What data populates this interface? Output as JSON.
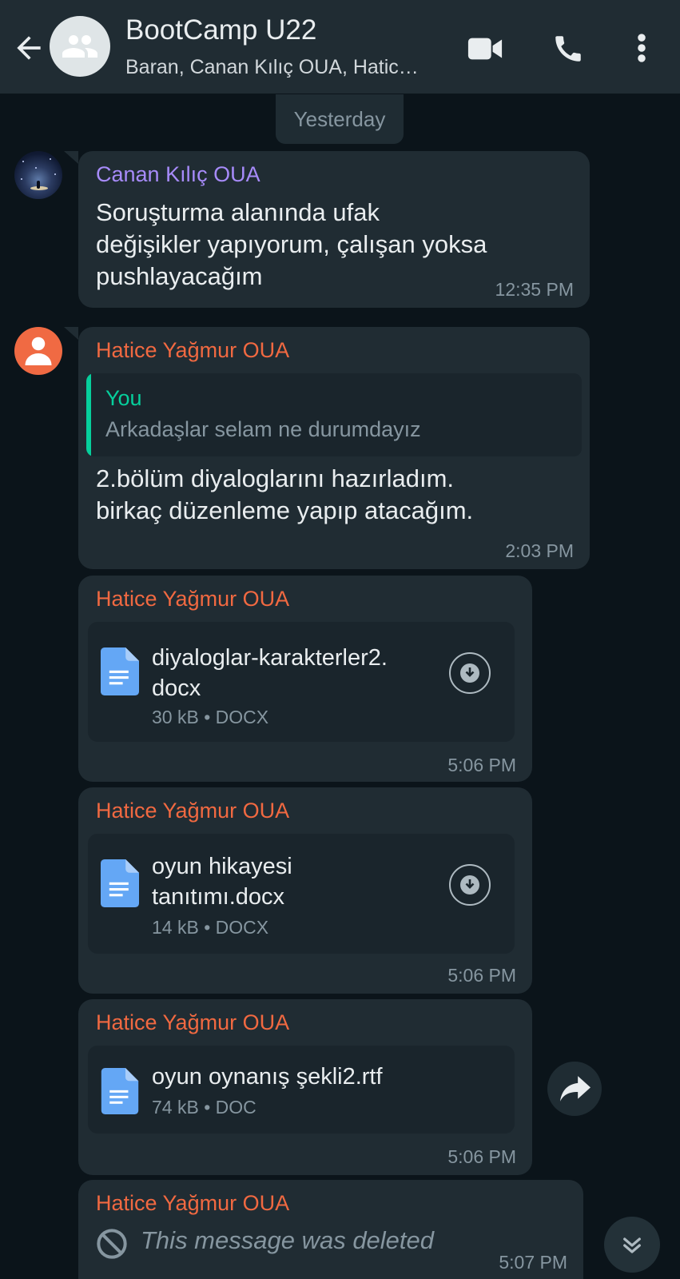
{
  "header": {
    "title": "BootCamp U22",
    "subtitle": "Baran, Canan Kılıç OUA, Hatic…",
    "icons": [
      "back-arrow-icon",
      "group-avatar-icon",
      "video-call-icon",
      "phone-icon",
      "more-vertical-icon"
    ]
  },
  "date_chip": "Yesterday",
  "messages": [
    {
      "sender": "Canan Kılıç OUA",
      "text_lines": [
        "Soruşturma alanında ufak",
        "değişikler yapıyorum, çalışan yoksa",
        "pushlayacağım"
      ],
      "time": "12:35 PM"
    },
    {
      "sender": "Hatice Yağmur OUA",
      "quote": {
        "author": "You",
        "text": "Arkadaşlar selam ne durumdayız"
      },
      "text_lines": [
        "2.bölüm diyaloglarını hazırladım.",
        "birkaç düzenleme yapıp atacağım."
      ],
      "time": "2:03 PM"
    },
    {
      "sender": "Hatice Yağmur OUA",
      "doc": {
        "name_lines": [
          "diyaloglar-karakterler2.",
          "docx"
        ],
        "meta": "30 kB • DOCX"
      },
      "time": "5:06 PM"
    },
    {
      "sender": "Hatice Yağmur OUA",
      "doc": {
        "name_lines": [
          "oyun hikayesi",
          "tanıtımı.docx"
        ],
        "meta": "14 kB • DOCX"
      },
      "time": "5:06 PM"
    },
    {
      "sender": "Hatice Yağmur OUA",
      "doc": {
        "name_lines": [
          "oyun oynanış şekli2.rtf"
        ],
        "meta": "74 kB • DOC"
      },
      "time": "5:06 PM"
    },
    {
      "sender": "Hatice Yağmur OUA",
      "deleted_text": "This message was deleted",
      "time": "5:07 PM"
    }
  ],
  "colors": {
    "background": "#0b141a",
    "bubble": "#202c33",
    "sender_purple": "#a78bfa",
    "sender_orange": "#f16941",
    "quote_accent": "#06cf9c",
    "muted": "#8696a0"
  }
}
